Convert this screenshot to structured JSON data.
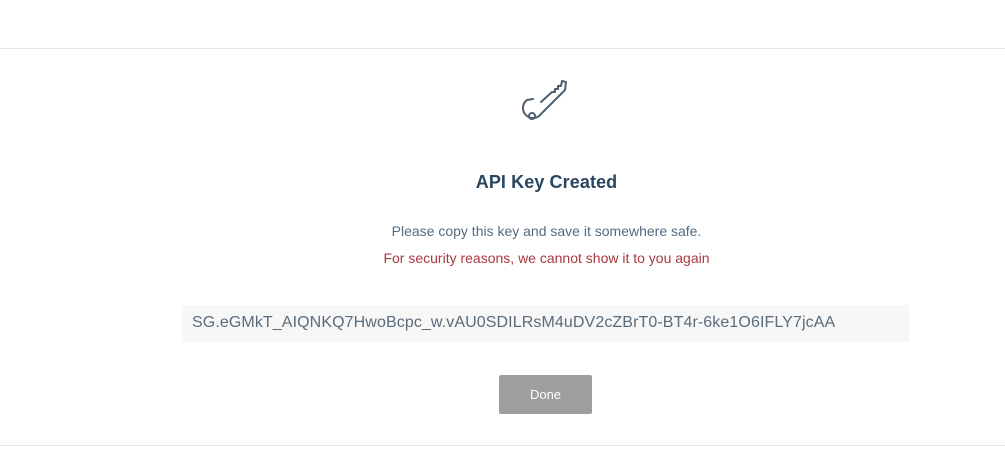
{
  "modal": {
    "icon": "key-icon",
    "title": "API Key Created",
    "instruction": "Please copy this key and save it somewhere safe.",
    "warning": "For security reasons, we cannot show it to you again",
    "api_key": "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",
    "done_label": "Done"
  },
  "colors": {
    "title": "#294661",
    "text": "#546b81",
    "warning": "#a9393e",
    "button": "#9e9e9e",
    "key_box": "#f7f7f7"
  }
}
